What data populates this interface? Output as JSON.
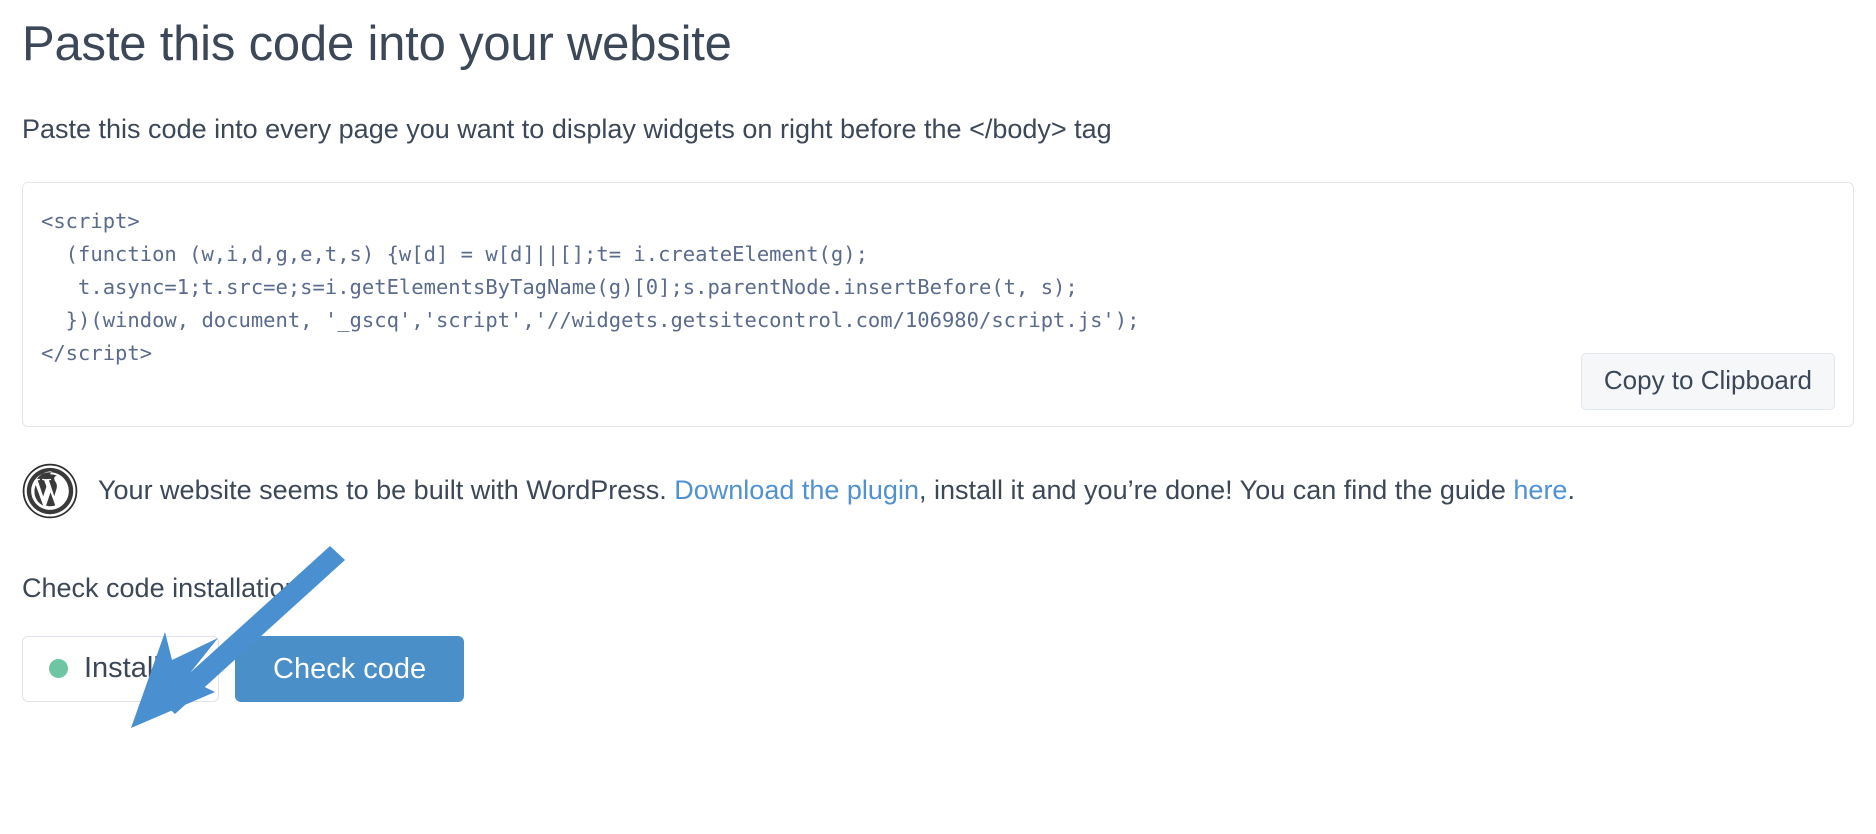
{
  "header": {
    "title": "Paste this code into your website",
    "subtitle": "Paste this code into every page you want to display widgets on right before the </body> tag"
  },
  "code_panel": {
    "snippet": "<script>\n  (function (w,i,d,g,e,t,s) {w[d] = w[d]||[];t= i.createElement(g);\n   t.async=1;t.src=e;s=i.getElementsByTagName(g)[0];s.parentNode.insertBefore(t, s);\n  })(window, document, '_gscq','script','//widgets.getsitecontrol.com/106980/script.js');\n</script>",
    "copy_button_label": "Copy to Clipboard",
    "widget_id": "106980",
    "widget_script_url": "//widgets.getsitecontrol.com/106980/script.js"
  },
  "wordpress_notice": {
    "icon": "wordpress-logo-icon",
    "text_before_link": "Your website seems to be built with WordPress. ",
    "download_link_label": "Download the plugin",
    "text_middle": ", install it and you’re done! You can find the guide ",
    "guide_link_label": "here",
    "text_after": "."
  },
  "check_section": {
    "label": "Check code installation",
    "status_label": "Installed",
    "status_dot_color": "#6ec5a3",
    "check_button_label": "Check code",
    "check_button_color": "#4a8fc7"
  },
  "annotation": {
    "arrow_color": "#4a8fd0",
    "points_to": "Installed"
  }
}
